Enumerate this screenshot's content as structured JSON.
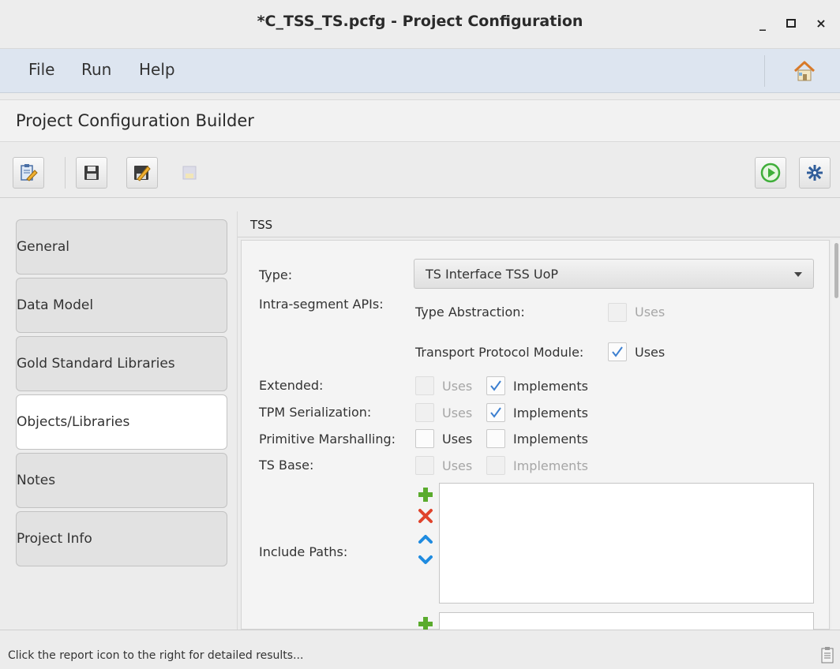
{
  "window": {
    "title": "*C_TSS_TS.pcfg - Project Configuration",
    "minimize": "_",
    "maximize": "▫",
    "close": "×"
  },
  "menu": {
    "file": "File",
    "run": "Run",
    "help": "Help"
  },
  "header": {
    "title": "Project Configuration Builder"
  },
  "nav": {
    "tabs": [
      {
        "label": "General"
      },
      {
        "label": "Data Model"
      },
      {
        "label": "Gold Standard Libraries"
      },
      {
        "label": "Objects/Libraries"
      },
      {
        "label": "Notes"
      },
      {
        "label": "Project Info"
      }
    ],
    "active": "Objects/Libraries"
  },
  "section": {
    "title": "TSS"
  },
  "form": {
    "type_label": "Type:",
    "type_value": "TS Interface TSS UoP",
    "intra_label": "Intra-segment APIs:",
    "type_abstraction_label": "Type Abstraction:",
    "type_abstraction_uses": "Uses",
    "tpm_label": "Transport Protocol Module:",
    "tpm_uses": "Uses",
    "extended_label": "Extended:",
    "extended_uses": "Uses",
    "extended_implements": "Implements",
    "tpm_serial_label": "TPM Serialization:",
    "tpm_serial_uses": "Uses",
    "tpm_serial_implements": "Implements",
    "prim_label": "Primitive Marshalling:",
    "prim_uses": "Uses",
    "prim_implements": "Implements",
    "tsbase_label": "TS Base:",
    "tsbase_uses": "Uses",
    "tsbase_implements": "Implements",
    "include_paths_label": "Include Paths:"
  },
  "status": {
    "message": "Click the report icon to the right for detailed results..."
  },
  "colors": {
    "add": "#5aab2d",
    "remove": "#e0432b",
    "move": "#1f8be0",
    "run": "#3fae3a",
    "menu_bg": "#dde5f0"
  },
  "icons": [
    "edit-icon",
    "save-icon",
    "save-as-icon",
    "disabled-save-icon",
    "run-icon",
    "settings-icon",
    "home-icon",
    "report-icon",
    "add-icon",
    "remove-icon",
    "move-up-icon",
    "move-down-icon",
    "chevron-down-icon",
    "check-icon"
  ]
}
